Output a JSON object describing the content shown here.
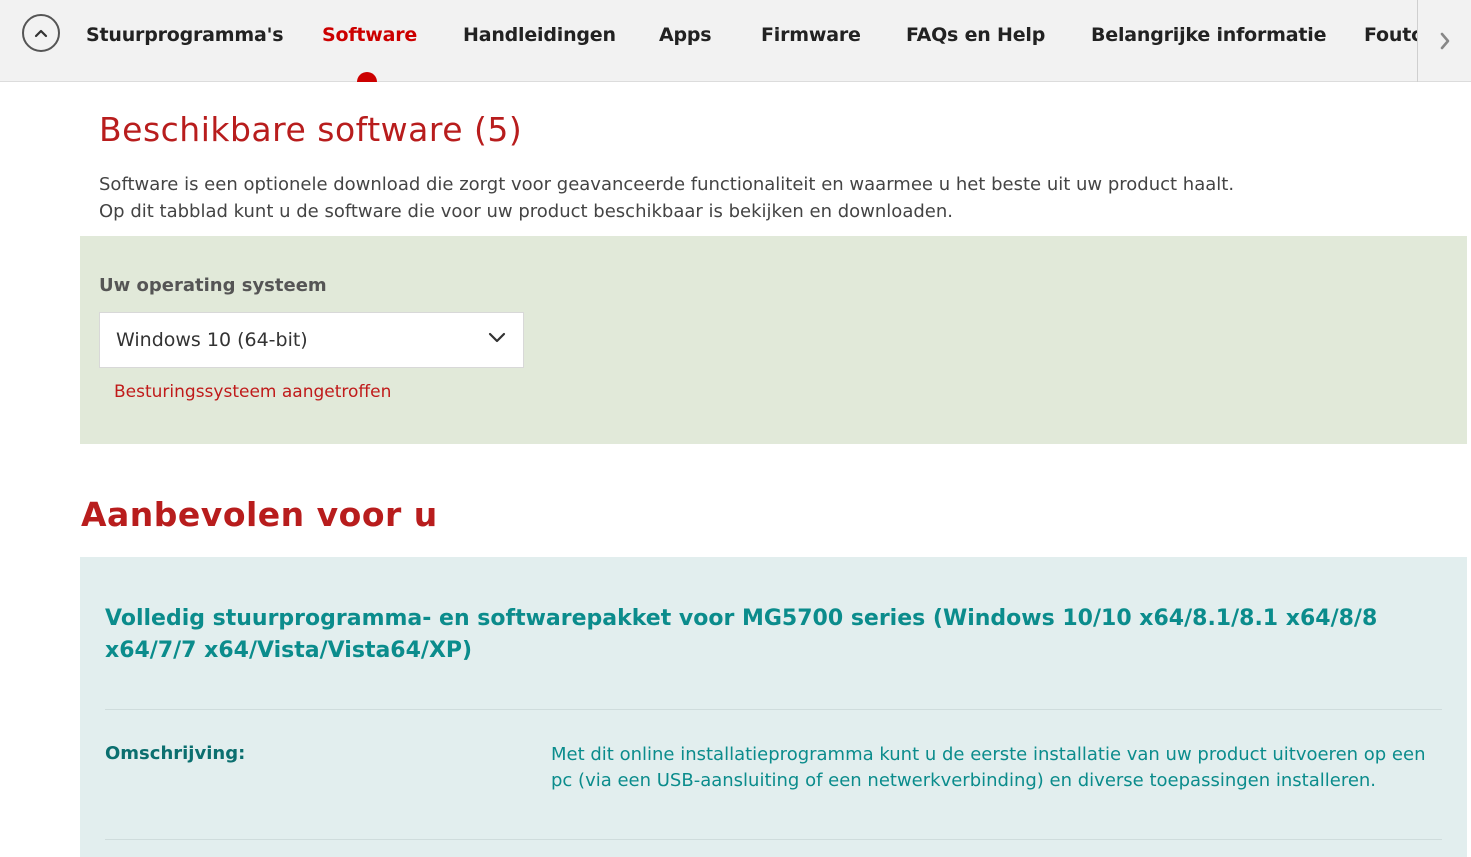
{
  "nav": {
    "tabs": [
      {
        "label": "Stuurprogramma's",
        "active": false
      },
      {
        "label": "Software",
        "active": true
      },
      {
        "label": "Handleidingen",
        "active": false
      },
      {
        "label": "Apps",
        "active": false
      },
      {
        "label": "Firmware",
        "active": false
      },
      {
        "label": "FAQs en Help",
        "active": false
      },
      {
        "label": "Belangrijke informatie",
        "active": false
      },
      {
        "label": "Foutcodes",
        "active": false
      }
    ],
    "scroll_up_icon": "chevron-up-icon",
    "next_icon": "chevron-right-icon",
    "accent_color": "#cc0000"
  },
  "page": {
    "title": "Beschikbare software (5)",
    "intro_line1": "Software is een optionele download die zorgt voor geavanceerde functionaliteit en waarmee u het beste uit uw product haalt.",
    "intro_line2": "Op dit tabblad kunt u de software die voor uw product beschikbaar is bekijken en downloaden."
  },
  "os": {
    "label": "Uw operating systeem",
    "selected": "Windows 10 (64-bit)",
    "detected_text": "Besturingssysteem aangetroffen",
    "panel_color": "#e1e9d9"
  },
  "recommended": {
    "title": "Aanbevolen voor u",
    "item_title": "Volledig stuurprogramma- en softwarepakket voor MG5700 series (Windows 10/10 x64/8.1/8.1 x64/8/8 x64/7/7 x64/Vista/Vista64/XP)",
    "description_label": "Omschrijving:",
    "description_text": "Met dit online installatieprogramma kunt u de eerste installatie van uw product uitvoeren op een pc (via een USB-aansluiting of een netwerkverbinding) en diverse toepassingen installeren.",
    "panel_color": "#e2eeee",
    "text_color": "#0b8c8c"
  }
}
